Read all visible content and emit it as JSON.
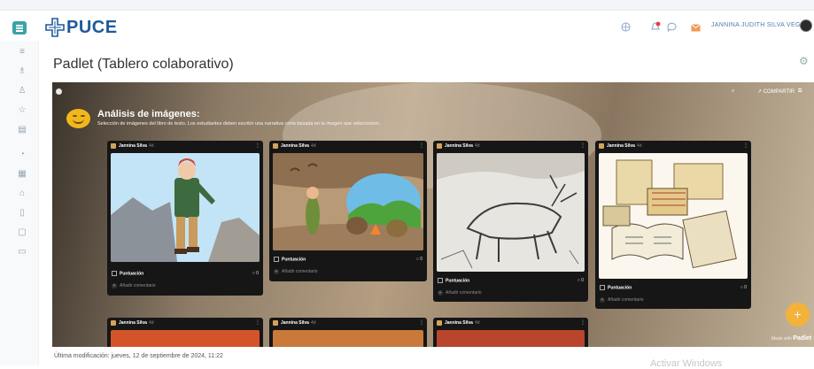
{
  "header": {
    "logo_text": "PUCE",
    "user_name": "JANNINA JUDITH SILVA VEGA",
    "accent": "#3aa3a6",
    "brand_color": "#1e5a9a",
    "icons": [
      "globe-icon",
      "bell-icon",
      "chat-icon",
      "mail-icon"
    ],
    "notification_badge_color": "#e63946"
  },
  "sidebar": {
    "icons": [
      "list-icon",
      "users-icon",
      "user-icon",
      "star-icon",
      "library-icon",
      "history-icon",
      "calendar-icon",
      "graduation-icon",
      "book-icon",
      "clipboard-icon",
      "folder-icon"
    ]
  },
  "page": {
    "title": "Padlet (Tablero colaborativo)",
    "last_modified": "Última modificación: jueves, 12 de septiembre de 2024, 11:22"
  },
  "padlet": {
    "title": "Análisis de imágenes:",
    "description": "Selección de imágenes del libro de texto. Los estudiantes deben escribir una narrativa corta basada en la imagen que seleccionen.",
    "share_label": "↗ COMPARTIR",
    "fab_label": "+",
    "made_with_prefix": "Made with",
    "made_with_brand": "Padlet",
    "cards": [
      {
        "author": "Jannina Silva",
        "time": "4d",
        "rating_label": "Puntuación",
        "comment_count": "0",
        "add_comment": "Añadir comentario",
        "image": "cartoon-explorer"
      },
      {
        "author": "Jannina Silva",
        "time": "4d",
        "rating_label": "Puntuación",
        "comment_count": "0",
        "add_comment": "Añadir comentario",
        "image": "cave-family"
      },
      {
        "author": "Jannina Silva",
        "time": "4d",
        "rating_label": "Puntuación",
        "comment_count": "0",
        "add_comment": "Añadir comentario",
        "image": "cave-painting"
      },
      {
        "author": "Jannina Silva",
        "time": "4d",
        "rating_label": "Puntuación",
        "comment_count": "0",
        "add_comment": "Añadir comentario",
        "image": "ancient-books"
      }
    ],
    "bottom_cards": [
      {
        "author": "Jannina Silva",
        "time": "4d"
      },
      {
        "author": "Jannina Silva",
        "time": "4d"
      },
      {
        "author": "Jannina Silva",
        "time": "4d"
      }
    ]
  },
  "os_watermark": "Activar Windows"
}
